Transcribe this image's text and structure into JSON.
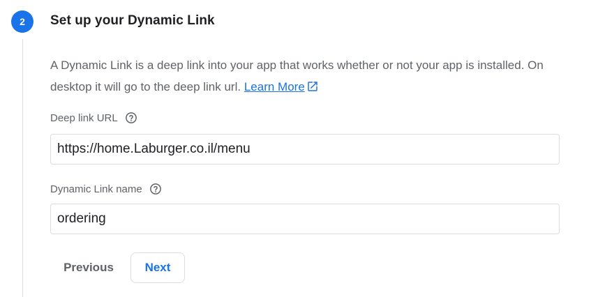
{
  "step": {
    "number": "2",
    "title": "Set up your Dynamic Link",
    "description": "A Dynamic Link is a deep link into your app that works whether or not your app is installed. On desktop it will go to the deep link url.",
    "learn_more_label": "Learn More"
  },
  "fields": {
    "deep_link": {
      "label": "Deep link URL",
      "value": "https://home.Laburger.co.il/menu"
    },
    "link_name": {
      "label": "Dynamic Link name",
      "value": "ordering"
    }
  },
  "buttons": {
    "previous_label": "Previous",
    "next_label": "Next"
  },
  "colors": {
    "accent": "#1a73e8",
    "secondary_text": "#5f6368",
    "border": "#dadce0"
  },
  "icons": {
    "external_link": "open-in-new-icon",
    "help": "help-circle-icon"
  }
}
